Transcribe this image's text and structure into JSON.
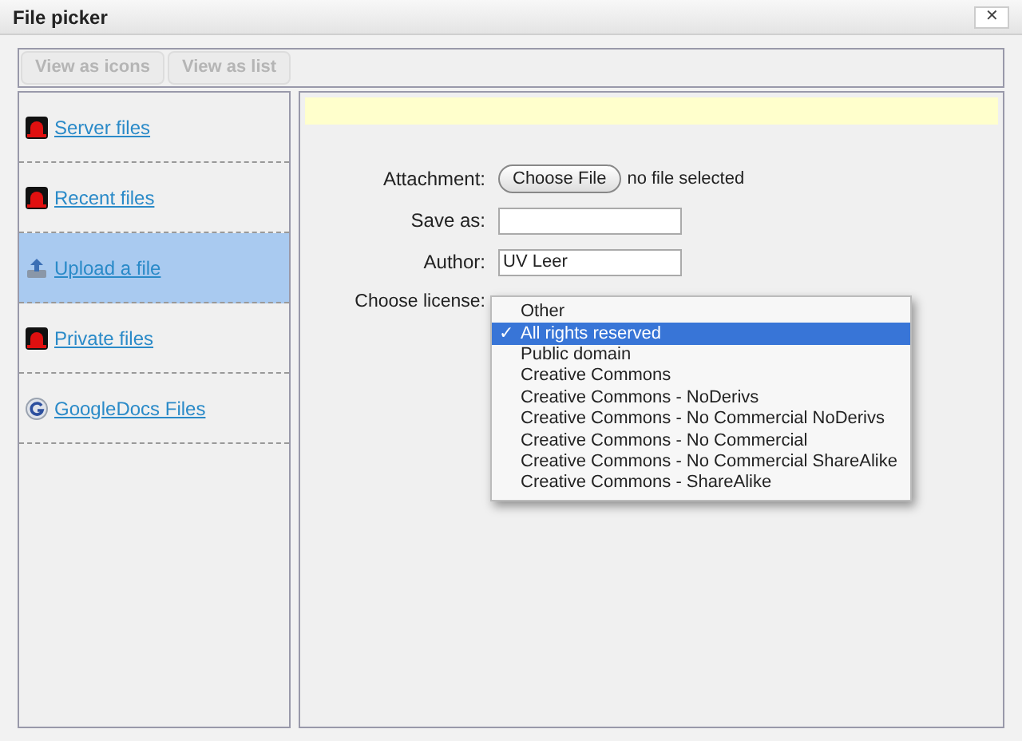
{
  "window": {
    "title": "File picker",
    "close": "✕"
  },
  "toolbar": [
    {
      "label": "View as icons",
      "disabled": true
    },
    {
      "label": "View as list",
      "disabled": true
    }
  ],
  "sidebar": {
    "items": [
      {
        "label": "Server files",
        "kind": "repo",
        "selected": false
      },
      {
        "label": "Recent files",
        "kind": "repo",
        "selected": false
      },
      {
        "label": "Upload a file",
        "kind": "upload",
        "selected": true
      },
      {
        "label": "Private files",
        "kind": "repo",
        "selected": false
      },
      {
        "label": "GoogleDocs Files",
        "kind": "google",
        "selected": false
      }
    ]
  },
  "form": {
    "attachment": {
      "label": "Attachment:",
      "button": "Choose File",
      "status": "no file selected"
    },
    "save_as": {
      "label": "Save as:"
    },
    "author": {
      "label": "Author:",
      "value": "UV Leer"
    },
    "license": {
      "label": "Choose license:",
      "options": [
        {
          "label": "Other",
          "selected": false
        },
        {
          "label": "All rights reserved",
          "selected": true
        },
        {
          "label": "Public domain",
          "selected": false
        },
        {
          "label": "Creative Commons",
          "selected": false
        },
        {
          "label": "Creative Commons - NoDerivs",
          "selected": false
        },
        {
          "label": "Creative Commons - No Commercial NoDerivs",
          "selected": false
        },
        {
          "label": "Creative Commons - No Commercial",
          "selected": false
        },
        {
          "label": "Creative Commons - No Commercial ShareAlike",
          "selected": false
        },
        {
          "label": "Creative Commons - ShareAlike",
          "selected": false
        }
      ],
      "check": "✓"
    }
  }
}
